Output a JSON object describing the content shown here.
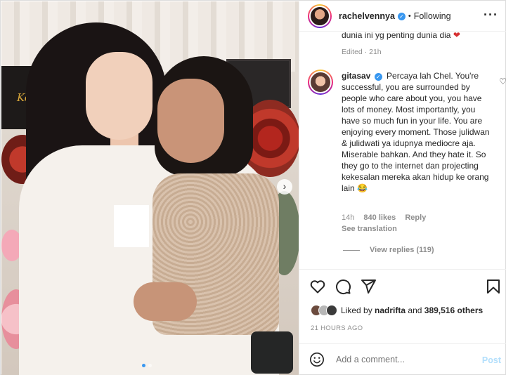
{
  "post": {
    "username": "rachelvennya",
    "verified_mark": "✓",
    "separator": "•",
    "follow_status": "Following",
    "more_label": "···",
    "caption_fragment": "dunia ini yg penting dunia dia",
    "caption_emoji": "❤",
    "edited": "Edited · 21h",
    "photo_next": "›"
  },
  "comment": {
    "username": "gitasav",
    "text": "Percaya lah Chel. You're successful, you are surrounded by people who care about you, you have lots of money. Most importantly, you have so much fun in your life. You are enjoying every moment. Those julidwan & julidwati ya idupnya mediocre aja. Miserable bahkan. And they hate it. So they go to the internet dan projecting kekesalan mereka akan hidup ke orang lain 😂",
    "time": "14h",
    "likes": "840 likes",
    "reply": "Reply",
    "see_translation": "See translation",
    "view_replies": "View replies (119)",
    "like_icon": "♡"
  },
  "likes_row": {
    "prefix": "Liked by",
    "user": "nadrifta",
    "and": "and",
    "count": "389,516 others"
  },
  "posted_ago": "21 HOURS AGO",
  "comment_box": {
    "placeholder": "Add a comment...",
    "post_label": "Post"
  },
  "colors": {
    "verified": "#3897f0",
    "post_disabled": "#b2dffc",
    "muted": "#8e8e8e"
  },
  "icons": [
    "heart-icon",
    "comment-icon",
    "share-icon",
    "bookmark-icon",
    "emoji-icon",
    "more-icon"
  ]
}
